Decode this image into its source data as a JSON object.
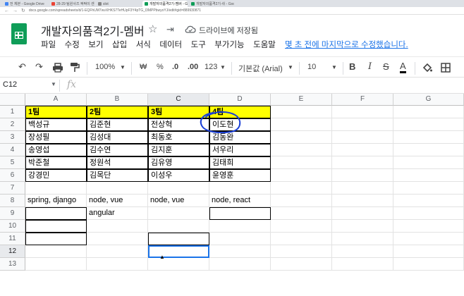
{
  "browser": {
    "tabs": [
      {
        "label": "전 체본 - Google Drive",
        "color": "#4285f4",
        "active": false
      },
      {
        "label": "28-29 팀원사즈 팍팍이 센",
        "color": "#ea4335",
        "active": false
      },
      {
        "label": "slot",
        "color": "#888888",
        "active": false
      },
      {
        "label": "개발자의품격2기-멤버 - Google 스",
        "color": "#0f9d58",
        "active": true
      },
      {
        "label": "개발자의품격2기-쉬 - Google 스",
        "color": "#0f9d58",
        "active": false
      }
    ],
    "url": "docs.google.com/spreadsheets/d/1-EQFhUM7wvXHKS7TeHUpF3Y4pTG_l3MPPbwyoYJ/edit#gid=889930871"
  },
  "header": {
    "title": "개발자의품격2기-멤버",
    "star_icon": "☆",
    "move_icon": "⇥",
    "drive_status": "드라이브에 저장됨",
    "last_edit": "몇 초 전에 마지막으로 수정했습니다."
  },
  "menu": [
    "파일",
    "수정",
    "보기",
    "삽입",
    "서식",
    "데이터",
    "도구",
    "부가기능",
    "도움말"
  ],
  "toolbar": {
    "zoom": "100%",
    "currency": "₩",
    "percent": "%",
    "dec_decrease": ".0",
    "dec_increase": ".00",
    "number_format": "123",
    "font": "기본값 (Arial)",
    "font_size": "10",
    "bold": "B",
    "italic": "I",
    "strike": "S",
    "text_color": "A"
  },
  "formula_bar": {
    "name_box": "C12",
    "fx": "fx"
  },
  "sheet": {
    "columns": [
      "A",
      "B",
      "C",
      "D",
      "E",
      "F",
      "G"
    ],
    "rows": [
      "1",
      "2",
      "3",
      "4",
      "5",
      "6",
      "7",
      "8",
      "9",
      "10",
      "11",
      "12",
      "13"
    ],
    "selected_cell": "C12",
    "teams_header": [
      "1팀",
      "2팀",
      "3팀",
      "4팀"
    ],
    "members": [
      [
        "백성규",
        "김준현",
        "전상혁",
        "이도현"
      ],
      [
        "장성필",
        "김성대",
        "최동호",
        "김동완"
      ],
      [
        "송영섭",
        "김수연",
        "김지훈",
        "서우리"
      ],
      [
        "박준철",
        "정원석",
        "김유영",
        "김태희"
      ],
      [
        "강경민",
        "김목단",
        "이성우",
        "윤영훈"
      ]
    ],
    "stacks_row8": [
      "spring, django",
      "node, vue",
      "node, vue",
      "node, react"
    ],
    "stack_row9_b": "angular"
  },
  "colors": {
    "highlight": "#ffff00",
    "selection": "#1a73e8",
    "annotation": "#1a3fd6",
    "sheets_green": "#0f9d58"
  }
}
